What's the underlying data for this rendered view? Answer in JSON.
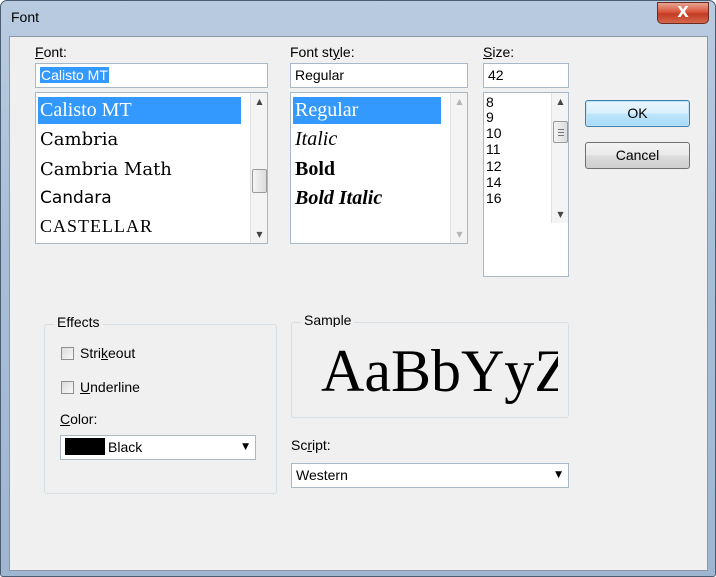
{
  "dialog": {
    "title": "Font",
    "close_glyph": "X",
    "chrome_colors": {
      "title_bar": "#a9bfd8",
      "close_button": "#c9462c",
      "selection": "#3399ff"
    }
  },
  "font": {
    "label": "Font:",
    "label_mnemonic": "F",
    "label_rest": "ont:",
    "value": "Calisto MT",
    "items": [
      "Calisto MT",
      "Cambria",
      "Cambria Math",
      "Candara",
      "CASTELLAR"
    ],
    "selected_index": 0
  },
  "font_style": {
    "label": "Font style:",
    "label_pre": "Font st",
    "label_mnemonic": "y",
    "label_post": "le:",
    "value": "Regular",
    "items": [
      "Regular",
      "Italic",
      "Bold",
      "Bold Italic"
    ],
    "selected_index": 0
  },
  "size": {
    "label": "Size:",
    "label_mnemonic": "S",
    "label_rest": "ize:",
    "value": "42",
    "items": [
      "8",
      "9",
      "10",
      "11",
      "12",
      "14",
      "16"
    ]
  },
  "buttons": {
    "ok": "OK",
    "cancel": "Cancel"
  },
  "effects": {
    "title": "Effects",
    "strikeout_pre": "Stri",
    "strikeout_mnemonic": "k",
    "strikeout_post": "eout",
    "strikeout_checked": false,
    "underline_mnemonic": "U",
    "underline_rest": "nderline",
    "underline_checked": false,
    "color_label_mnemonic": "C",
    "color_label_rest": "olor:",
    "color_value": "Black",
    "color_swatch": "#000000"
  },
  "sample": {
    "title": "Sample",
    "text": "AaBbYyZz"
  },
  "script": {
    "label_pre": "Sc",
    "label_mnemonic": "r",
    "label_post": "ipt:",
    "value": "Western"
  },
  "icons": {
    "scroll_up": "up-arrow-icon",
    "scroll_down": "down-arrow-icon",
    "dropdown": "dropdown-arrow-icon",
    "close": "close-icon"
  }
}
